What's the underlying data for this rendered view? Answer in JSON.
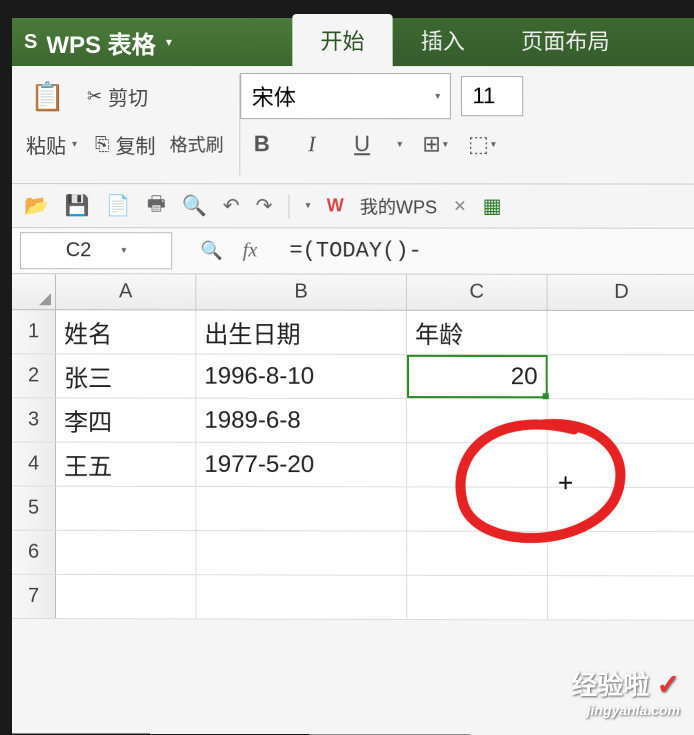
{
  "app": {
    "logo": "S",
    "title": "WPS 表格"
  },
  "tabs": {
    "start": "开始",
    "insert": "插入",
    "layout": "页面布局"
  },
  "ribbon": {
    "paste": "粘贴",
    "cut": "剪切",
    "copy": "复制",
    "format_painter": "格式刷",
    "font": "宋体",
    "size": "11",
    "bold": "B",
    "italic": "I",
    "underline": "U"
  },
  "wps_brand": {
    "logo": "W",
    "text": "我的WPS"
  },
  "namebox": "C2",
  "formula": "=(TODAY()-",
  "fx": "fx",
  "columns": [
    "A",
    "B",
    "C",
    "D"
  ],
  "rows": [
    "1",
    "2",
    "3",
    "4",
    "5",
    "6",
    "7"
  ],
  "headers": {
    "name": "姓名",
    "dob": "出生日期",
    "age": "年龄"
  },
  "data": [
    {
      "name": "张三",
      "dob": "1996-8-10",
      "age": "20"
    },
    {
      "name": "李四",
      "dob": "1989-6-8",
      "age": ""
    },
    {
      "name": "王五",
      "dob": "1977-5-20",
      "age": ""
    }
  ],
  "watermark": {
    "top": "经验啦",
    "check": "✓",
    "bottom": "jingyanla.com"
  }
}
